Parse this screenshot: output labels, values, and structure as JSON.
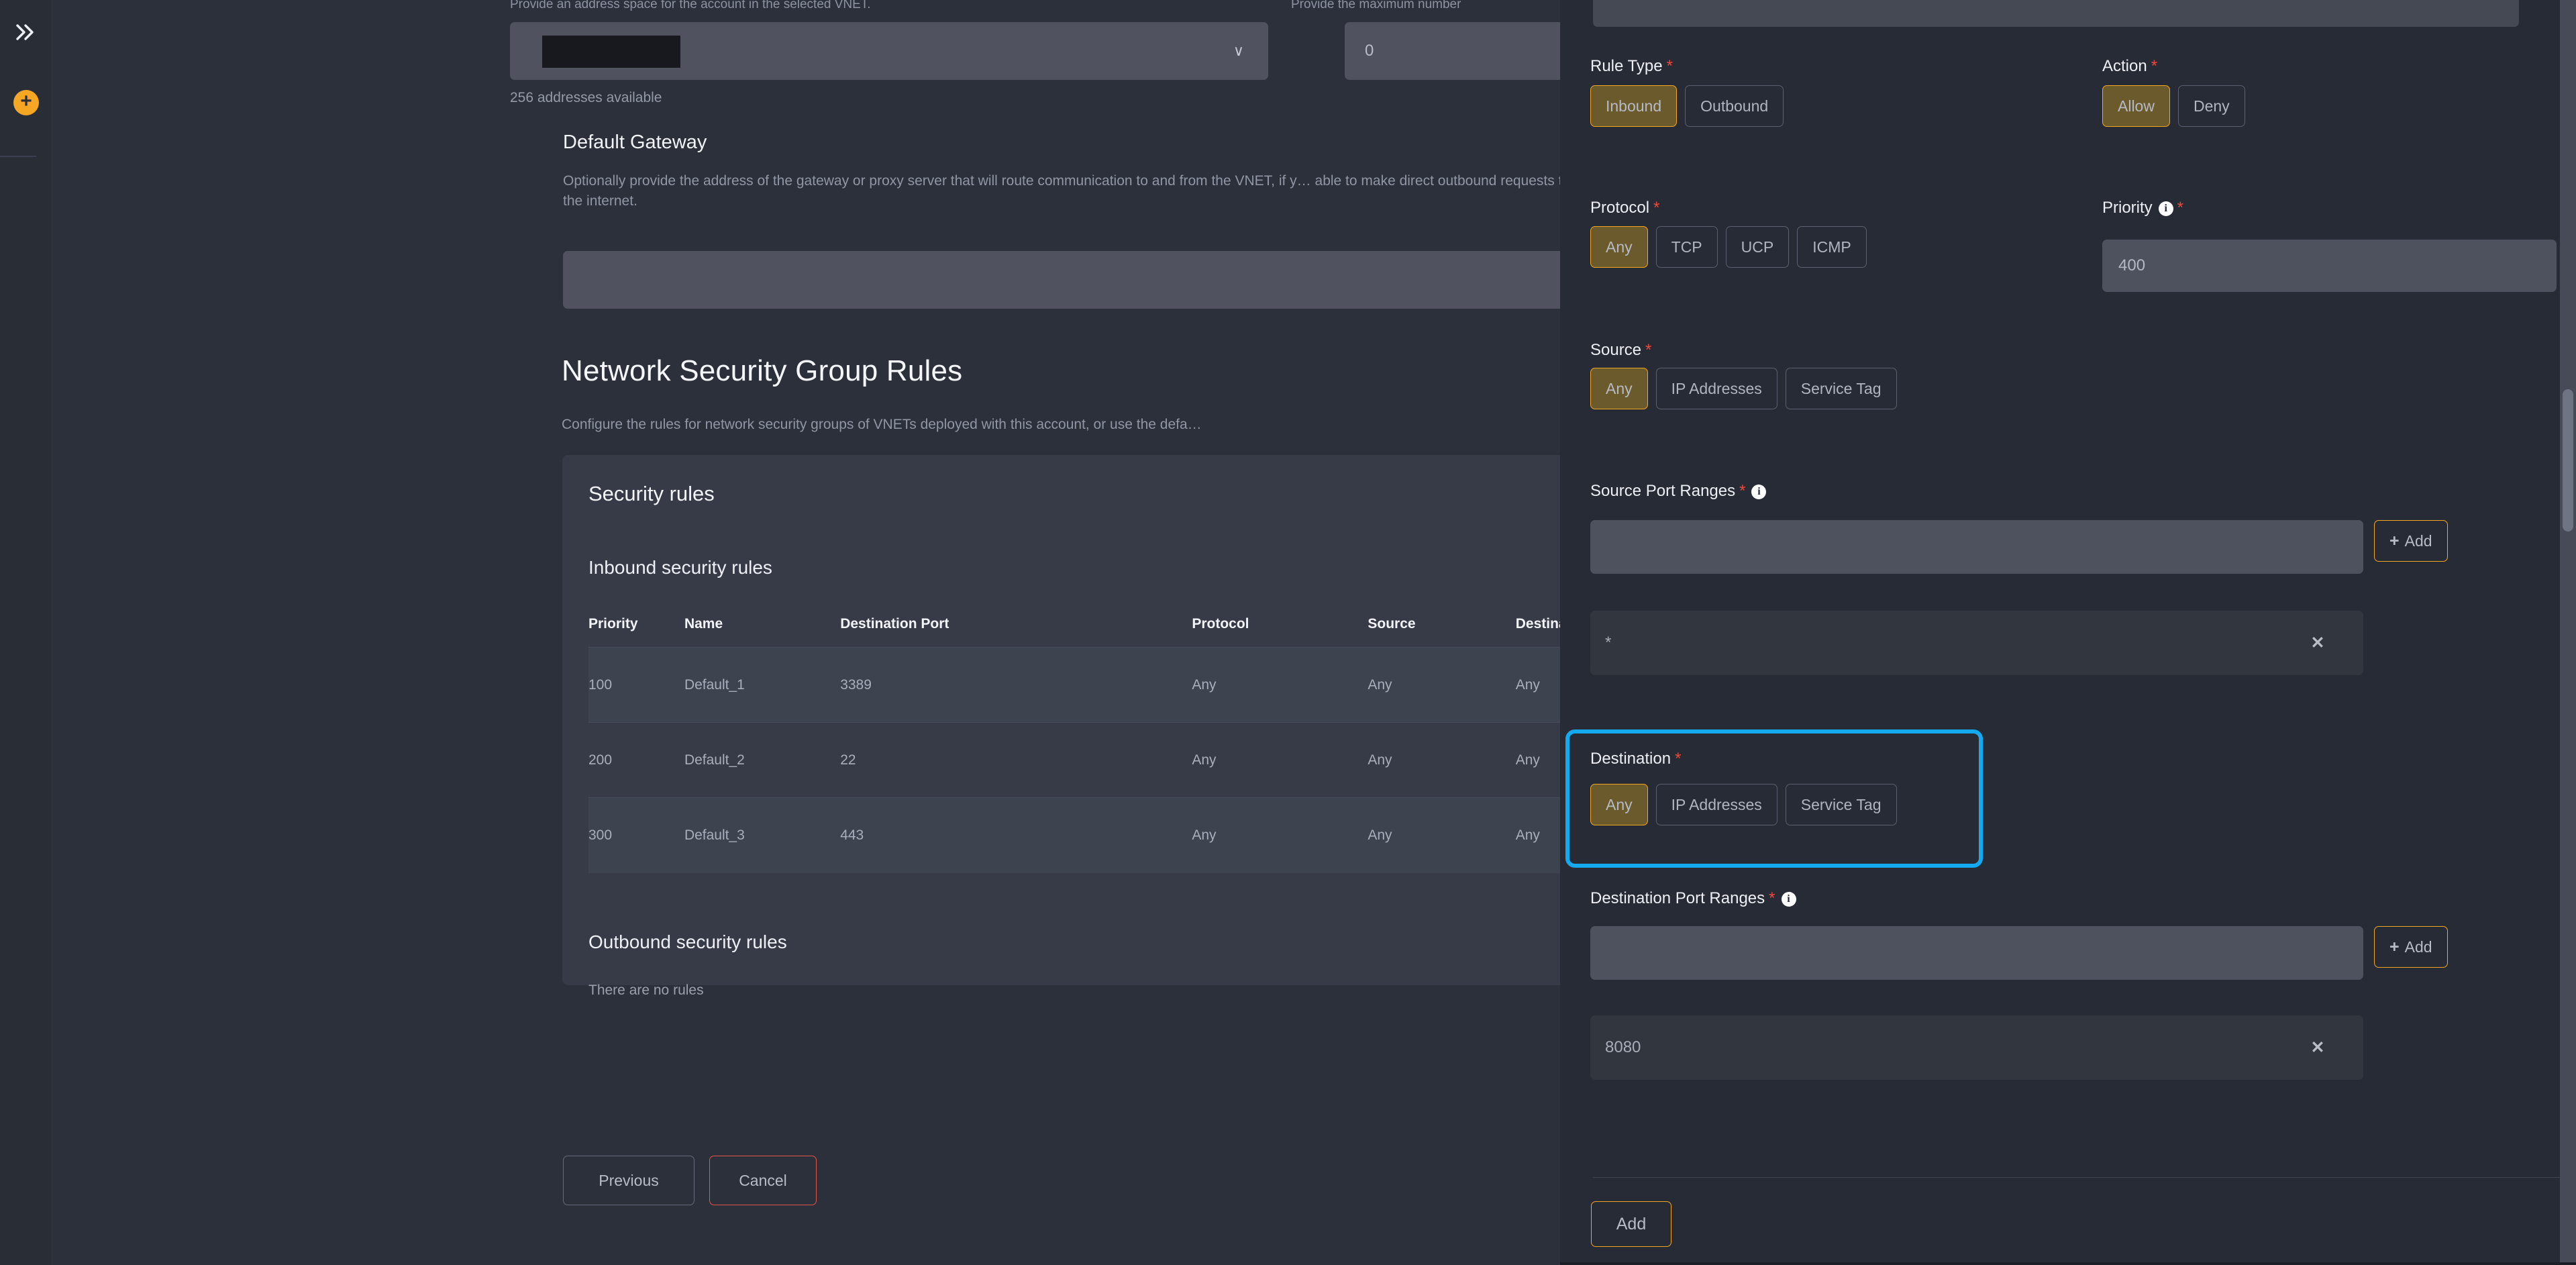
{
  "rail": {
    "expand_icon": "double-chevron-right-icon",
    "add_icon": "plus-circle-icon",
    "add_glyph": "+"
  },
  "left": {
    "top_hint": "Provide an address space for the account in the selected VNET.",
    "top_hint2": "Provide the maximum number",
    "address_select": {
      "value_redacted": true,
      "caret": "∨",
      "note": "256 addresses available"
    },
    "max_number_input": {
      "value": "0"
    },
    "default_gateway": {
      "title": "Default Gateway",
      "description": "Optionally provide the address of the gateway or proxy server that will route communication to and from the VNET, if y… able to make direct outbound requests to the internet.",
      "input_value": ""
    },
    "nsg": {
      "title": "Network Security Group Rules",
      "description": "Configure the rules for network security groups of VNETs deployed with this account, or use the defa…"
    },
    "rules_card": {
      "heading": "Security rules",
      "inbound_heading": "Inbound security rules",
      "columns": [
        "Priority",
        "Name",
        "Destination Port",
        "Protocol",
        "Source",
        "Destination"
      ],
      "rows": [
        {
          "priority": "100",
          "name": "Default_1",
          "destination_port": "3389",
          "protocol": "Any",
          "source": "Any",
          "destination": "Any"
        },
        {
          "priority": "200",
          "name": "Default_2",
          "destination_port": "22",
          "protocol": "Any",
          "source": "Any",
          "destination": "Any"
        },
        {
          "priority": "300",
          "name": "Default_3",
          "destination_port": "443",
          "protocol": "Any",
          "source": "Any",
          "destination": "Any"
        }
      ],
      "outbound_heading": "Outbound security rules",
      "outbound_empty": "There are no rules"
    },
    "footer": {
      "previous_label": "Previous",
      "cancel_label": "Cancel"
    }
  },
  "panel": {
    "rule_type": {
      "label": "Rule Type",
      "required": "*",
      "options": [
        "Inbound",
        "Outbound"
      ],
      "selected": "Inbound"
    },
    "action": {
      "label": "Action",
      "required": "*",
      "options": [
        "Allow",
        "Deny"
      ],
      "selected": "Allow"
    },
    "protocol": {
      "label": "Protocol",
      "required": "*",
      "options": [
        "Any",
        "TCP",
        "UCP",
        "ICMP"
      ],
      "selected": "Any"
    },
    "priority": {
      "label": "Priority",
      "required": "*",
      "info": "i",
      "value": "400"
    },
    "source": {
      "label": "Source",
      "required": "*",
      "options": [
        "Any",
        "IP Addresses",
        "Service Tag"
      ],
      "selected": "Any"
    },
    "source_port_ranges": {
      "label": "Source Port Ranges",
      "required": "*",
      "info": "i",
      "input_value": "",
      "add_label": "Add",
      "add_plus": "+",
      "chips": [
        {
          "value": "*",
          "remove": "✕"
        }
      ]
    },
    "destination": {
      "label": "Destination",
      "required": "*",
      "options": [
        "Any",
        "IP Addresses",
        "Service Tag"
      ],
      "selected": "Any",
      "highlighted": true,
      "highlight_color": "#15aaf0"
    },
    "destination_port_ranges": {
      "label": "Destination Port Ranges",
      "required": "*",
      "info": "i",
      "input_value": "",
      "add_label": "Add",
      "add_plus": "+",
      "chips": [
        {
          "value": "8080",
          "remove": "✕"
        }
      ]
    },
    "submit": {
      "label": "Add"
    }
  },
  "colors": {
    "accent_orange": "#f5a623",
    "selected_fill": "#6b5a2b",
    "required_red": "#f0483c",
    "cancel_red": "#e2564a",
    "highlight_cyan": "#15aaf0",
    "page_bg": "#2c303a",
    "panel_bg": "#272b35",
    "card_bg": "#373b47",
    "input_bg": "#4e525e"
  }
}
